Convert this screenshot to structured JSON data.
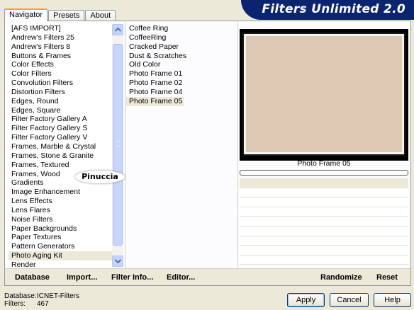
{
  "tabs": [
    "Navigator",
    "Presets",
    "About"
  ],
  "title": "Filters Unlimited 2.0",
  "categories": [
    "[AFS IMPORT]",
    "Andrew's Filters 25",
    "Andrew's Filters 8",
    "Buttons & Frames",
    "Color Effects",
    "Color Filters",
    "Convolution Filters",
    "Distortion Filters",
    "Edges, Round",
    "Edges, Square",
    "Filter Factory Gallery A",
    "Filter Factory Gallery S",
    "Filter Factory Gallery V",
    "Frames, Marble & Crystal",
    "Frames, Stone & Granite",
    "Frames, Textured",
    "Frames, Wood",
    "Gradients",
    "Image Enhancement",
    "Lens Effects",
    "Lens Flares",
    "Noise Filters",
    "Paper Backgrounds",
    "Paper Textures",
    "Pattern Generators",
    "Photo Aging Kit",
    "Render"
  ],
  "selected_category": "Photo Aging Kit",
  "filters": [
    "Coffee Ring",
    "CoffeeRing",
    "Cracked Paper",
    "Dust & Scratches",
    "Old Color",
    "Photo Frame 01",
    "Photo Frame 02",
    "Photo Frame 04",
    "Photo Frame 05"
  ],
  "selected_filter": "Photo Frame 05",
  "preview": {
    "filter_name": "Photo Frame 05",
    "fill_color": "#ddc9b3"
  },
  "watermark": "Pinuccia",
  "bottom_bar": {
    "database": "Database",
    "import": "Import...",
    "filter_info": "Filter Info...",
    "editor": "Editor...",
    "randomize": "Randomize",
    "reset": "Reset"
  },
  "footer": {
    "database_label": "Database:",
    "database_value": "ICNET-Filters",
    "filters_label": "Filters:",
    "filters_value": "467"
  },
  "buttons": {
    "apply": "Apply",
    "cancel": "Cancel",
    "help": "Help"
  },
  "icons": {
    "scroll_up": "chevron-up-icon",
    "scroll_down": "chevron-down-icon"
  }
}
